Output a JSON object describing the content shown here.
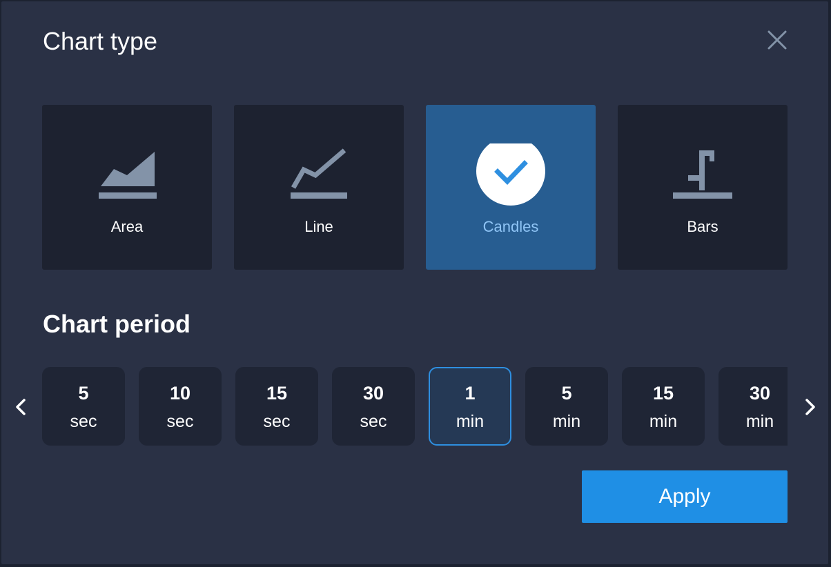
{
  "dialog": {
    "title": "Chart type",
    "close_icon": "close-icon"
  },
  "chart_types": [
    {
      "label": "Area",
      "icon": "area-chart-icon",
      "selected": false
    },
    {
      "label": "Line",
      "icon": "line-chart-icon",
      "selected": false
    },
    {
      "label": "Candles",
      "icon": "checkmark-icon",
      "selected": true
    },
    {
      "label": "Bars",
      "icon": "bars-chart-icon",
      "selected": false
    }
  ],
  "period": {
    "title": "Chart period",
    "prev_icon": "chevron-left-icon",
    "next_icon": "chevron-right-icon",
    "options": [
      {
        "value": "5",
        "unit": "sec",
        "selected": false
      },
      {
        "value": "10",
        "unit": "sec",
        "selected": false
      },
      {
        "value": "15",
        "unit": "sec",
        "selected": false
      },
      {
        "value": "30",
        "unit": "sec",
        "selected": false
      },
      {
        "value": "1",
        "unit": "min",
        "selected": true
      },
      {
        "value": "5",
        "unit": "min",
        "selected": false
      },
      {
        "value": "15",
        "unit": "min",
        "selected": false
      },
      {
        "value": "30",
        "unit": "min",
        "selected": false
      }
    ]
  },
  "actions": {
    "apply_label": "Apply"
  },
  "colors": {
    "dialog_bg": "#2a3145",
    "card_bg": "#1d2230",
    "selected_card_bg": "#275d91",
    "accent": "#1f8fe5",
    "icon_gray": "#8393a8"
  }
}
